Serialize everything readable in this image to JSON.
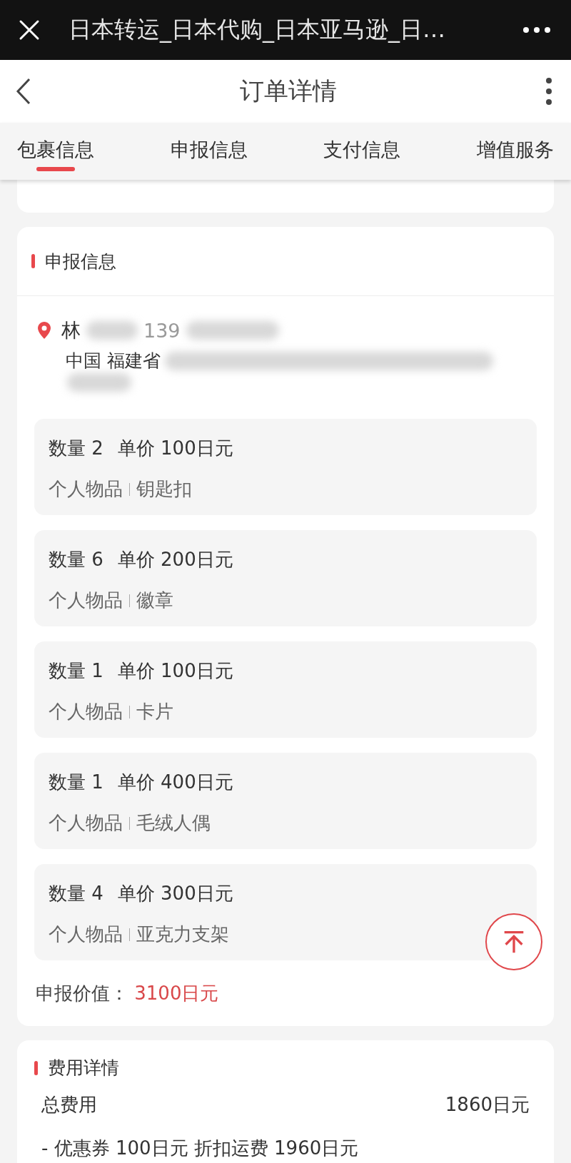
{
  "browser_bar": {
    "title": "日本转运_日本代购_日本亚马逊_日…"
  },
  "nav": {
    "title": "订单详情"
  },
  "tabs": [
    {
      "label": "包裹信息",
      "selected": true
    },
    {
      "label": "申报信息",
      "selected": false
    },
    {
      "label": "支付信息",
      "selected": false
    },
    {
      "label": "增值服务",
      "selected": false
    }
  ],
  "declaration": {
    "title": "申报信息",
    "recipient": {
      "name": "林",
      "phone": "139",
      "address": "中国 福建省"
    },
    "items": [
      {
        "quantity": "数量 2",
        "unit_price": "单价 100日元",
        "category": "个人物品",
        "name": "钥匙扣"
      },
      {
        "quantity": "数量 6",
        "unit_price": "单价 200日元",
        "category": "个人物品",
        "name": "徽章"
      },
      {
        "quantity": "数量 1",
        "unit_price": "单价 100日元",
        "category": "个人物品",
        "name": "卡片"
      },
      {
        "quantity": "数量 1",
        "unit_price": "单价 400日元",
        "category": "个人物品",
        "name": "毛绒人偶"
      },
      {
        "quantity": "数量 4",
        "unit_price": "单价 300日元",
        "category": "个人物品",
        "name": "亚克力支架"
      }
    ],
    "value_label": "申报价值：",
    "value": "3100日元"
  },
  "fees": {
    "title": "费用详情",
    "total_label": "总费用",
    "total": "1860日元",
    "breakdown": "- 优惠券 100日元 折扣运费 1960日元"
  }
}
